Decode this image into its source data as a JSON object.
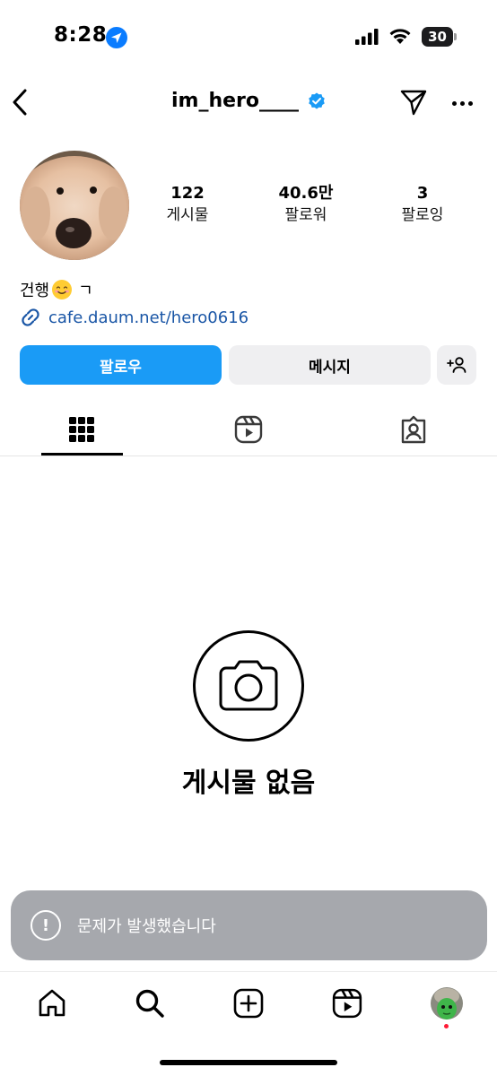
{
  "status_bar": {
    "time": "8:28",
    "battery": "30",
    "icons": [
      "location-arrow-icon",
      "signal-icon",
      "wifi-icon",
      "battery-icon"
    ]
  },
  "header": {
    "username": "im_hero____",
    "verified": true,
    "icons": [
      "back-arrow-icon",
      "verified-badge-icon",
      "send-icon",
      "more-icon"
    ]
  },
  "profile": {
    "stats": [
      {
        "value": "122",
        "label": "게시물"
      },
      {
        "value": "40.6만",
        "label": "팔로워"
      },
      {
        "value": "3",
        "label": "팔로잉"
      }
    ],
    "bio_text": "건행",
    "bio_suffix": "ㄱ",
    "link": "cafe.daum.net/hero0616"
  },
  "actions": {
    "follow_label": "팔로우",
    "message_label": "메시지"
  },
  "tabs": [
    "grid-icon",
    "reels-icon",
    "tagged-icon"
  ],
  "empty_state": {
    "title": "게시물 없음",
    "icon": "camera-icon"
  },
  "toast": {
    "message": "문제가 발생했습니다",
    "icon": "alert-icon"
  },
  "bottom_nav": {
    "items": [
      "home-icon",
      "search-icon",
      "create-icon",
      "reels-icon",
      "profile-avatar"
    ]
  },
  "colors": {
    "accent": "#1a9bf6",
    "link": "#1a56a6",
    "verified": "#1a9bf6",
    "toast_bg": "#a6a8ad",
    "notification_dot": "#ff1a35"
  }
}
